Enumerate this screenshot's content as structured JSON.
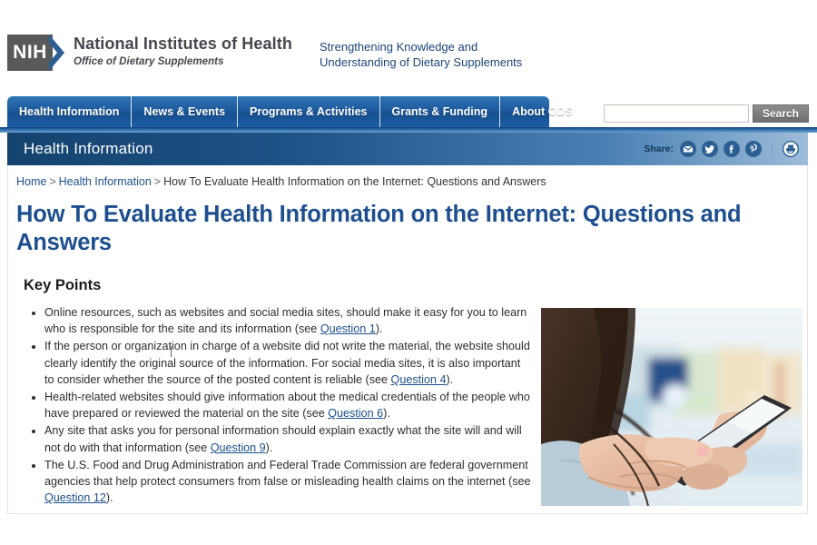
{
  "masthead": {
    "logo_mark": "NIH",
    "org_name": "National Institutes of Health",
    "org_sub": "Office of Dietary Supplements",
    "tagline_line1": "Strengthening Knowledge and",
    "tagline_line2": "Understanding of Dietary Supplements"
  },
  "nav": {
    "items": [
      {
        "label": "Health Information"
      },
      {
        "label": "News & Events"
      },
      {
        "label": "Programs & Activities"
      },
      {
        "label": "Grants & Funding"
      },
      {
        "label": "About ODS"
      }
    ]
  },
  "search": {
    "value": "",
    "placeholder": "",
    "button_label": "Search"
  },
  "section_bar": {
    "title": "Health Information",
    "share_label": "Share:",
    "icons": [
      {
        "name": "email-share-icon"
      },
      {
        "name": "twitter-share-icon"
      },
      {
        "name": "facebook-share-icon"
      },
      {
        "name": "pinterest-share-icon"
      },
      {
        "name": "print-icon"
      }
    ]
  },
  "breadcrumb": {
    "home": "Home",
    "section": "Health Information",
    "current": "How To Evaluate Health Information on the Internet: Questions and Answers",
    "separator": ">"
  },
  "main": {
    "page_title": "How To Evaluate Health Information on the Internet: Questions and Answers",
    "key_points_heading": "Key Points",
    "bullets": [
      {
        "text_before": "Online resources, such as websites and social media sites, should make it easy for you to learn who is responsible for the site and its information (see ",
        "link": "Question 1",
        "text_after": ")."
      },
      {
        "text_before": "If the person or organization in charge of a website did not write the material, the website should clearly identify the original source of the information. For social media sites, it is also important to consider whether the source of the posted content is reliable (see ",
        "link": "Question 4",
        "text_after": ")."
      },
      {
        "text_before": "Health-related websites should give information about the medical credentials of the people who have prepared or reviewed the material on the site (see ",
        "link": "Question 6",
        "text_after": ")."
      },
      {
        "text_before": "Any site that asks you for personal information should explain exactly what the site will and will not do with that information (see ",
        "link": "Question 9",
        "text_after": ")."
      },
      {
        "text_before": "The U.S. Food and Drug Administration and Federal Trade Commission are federal government agencies that help protect consumers from false or misleading health claims on the internet (see ",
        "link": "Question 12",
        "text_after": ")."
      }
    ],
    "photo_alt": "Person using a smartphone"
  },
  "colors": {
    "nav_blue": "#1d5b9e",
    "title_blue": "#1d4f8f",
    "link_blue": "#1b4f8a",
    "logo_gray": "#58595b",
    "share_icon_blue": "#2b5f93"
  }
}
